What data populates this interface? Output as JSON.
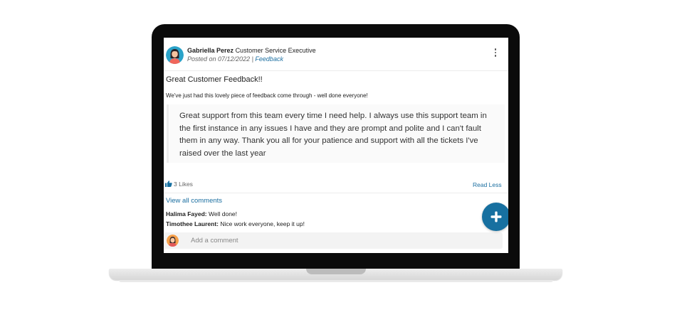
{
  "post": {
    "author_name": "Gabriella Perez",
    "author_role": "Customer Service Executive",
    "posted_prefix": "Posted on 07/12/2022 | ",
    "category": "Feedback",
    "title": "Great Customer Feedback!!",
    "intro": "We've just had this lovely piece of feedback come through - well done everyone!",
    "quote": "Great support from this team every time I need help. I always use this support team in the first instance in any issues I have and they are prompt and polite and I can't fault them in any way. Thank you all for your patience and support with all the tickets I've raised over the last year",
    "likes_label": "3 Likes",
    "read_less_label": "Read Less"
  },
  "comments": {
    "view_all_label": "View all comments",
    "items": [
      {
        "author": "Halima Fayed:",
        "text": "Well done!"
      },
      {
        "author": "Timothee Laurent:",
        "text": "Nice work everyone, keep it up!"
      }
    ],
    "input_placeholder": "Add a comment"
  },
  "icons": {
    "more": "more-vertical-icon",
    "like": "thumbs-up-icon",
    "fab": "plus-icon"
  },
  "colors": {
    "accent": "#1770a0",
    "link": "#1a6ea0",
    "laptop_bezel": "#0b0b0b"
  }
}
